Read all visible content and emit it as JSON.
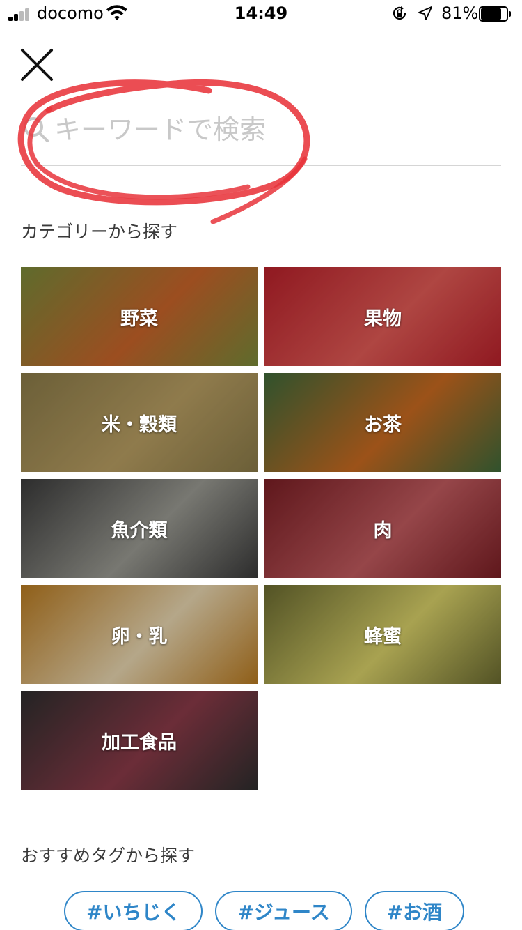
{
  "status_bar": {
    "carrier": "docomo",
    "time": "14:49",
    "battery": "81%",
    "battery_level": 0.81
  },
  "close_icon": "close-icon",
  "search": {
    "placeholder": "キーワードで検索",
    "value": ""
  },
  "categories": {
    "title": "カテゴリーから探す",
    "items": [
      {
        "label": "野菜",
        "color_a": "#7a8a3a",
        "color_b": "#c8642a"
      },
      {
        "label": "果物",
        "color_a": "#b8202a",
        "color_b": "#e05a55"
      },
      {
        "label": "米・穀類",
        "color_a": "#8a7a48",
        "color_b": "#b89e62"
      },
      {
        "label": "お茶",
        "color_a": "#3e6a3a",
        "color_b": "#c86a20"
      },
      {
        "label": "魚介類",
        "color_a": "#3a3a3a",
        "color_b": "#9a9a92"
      },
      {
        "label": "肉",
        "color_a": "#7a1e24",
        "color_b": "#c05a5e"
      },
      {
        "label": "卵・乳",
        "color_a": "#b87a20",
        "color_b": "#e8d6b0"
      },
      {
        "label": "蜂蜜",
        "color_a": "#6a6a30",
        "color_b": "#d8d068"
      },
      {
        "label": "加工食品",
        "color_a": "#2e2e2e",
        "color_b": "#8a3a48"
      }
    ]
  },
  "tags": {
    "title": "おすすめタグから探す",
    "items": [
      "#いちじく",
      "#ジュース",
      "#お酒"
    ]
  }
}
